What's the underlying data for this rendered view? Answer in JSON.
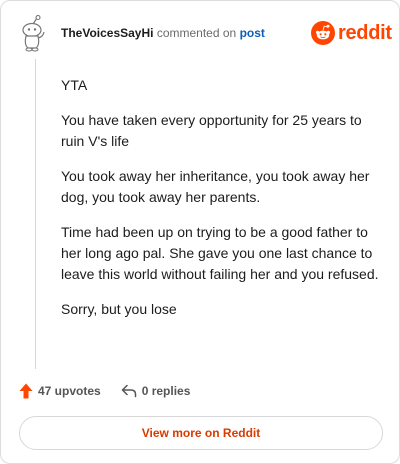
{
  "header": {
    "username": "TheVoicesSayHi",
    "action_text": "commented on",
    "post_link": "post"
  },
  "brand": {
    "logo_icon": "reddit-snoo-icon",
    "wordmark": "reddit",
    "color": "#ff4500"
  },
  "comment": {
    "paragraphs": [
      "YTA",
      "You have taken every opportunity for 25 years to ruin V's life",
      "You took away her inheritance, you took away her dog, you took away her parents.",
      "Time had been up on trying to be a good father to her long ago pal. She gave you one last chance to leave this world without failing her and you refused.",
      "Sorry, but you lose"
    ]
  },
  "footer": {
    "upvotes": "47 upvotes",
    "upvote_icon": "upvote-arrow-icon",
    "upvote_color": "#ff4500",
    "replies": "0 replies",
    "reply_icon": "reply-arrow-icon"
  },
  "view_more": {
    "label": "View more on Reddit",
    "color": "#d93a00"
  }
}
